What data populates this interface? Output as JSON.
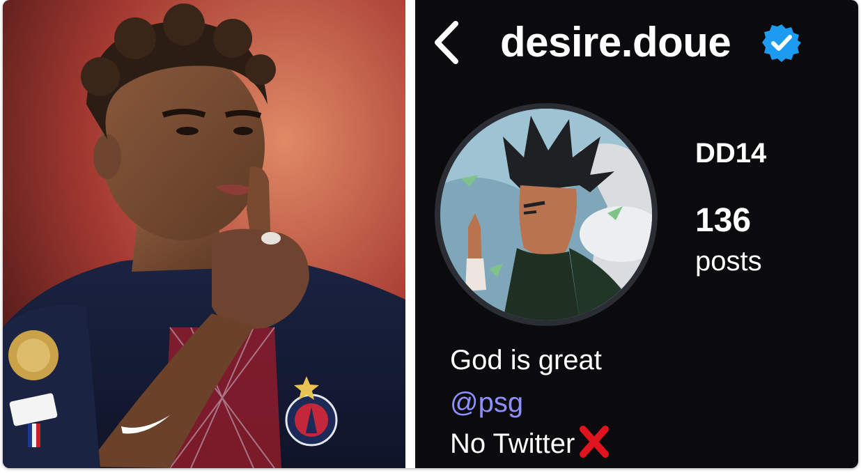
{
  "profile": {
    "username": "desire.doue",
    "display_name": "DD14",
    "post_count": "136",
    "post_label": "posts",
    "bio": {
      "line1": "God is great",
      "mention": "@psg",
      "line3": "No Twitter"
    }
  },
  "icons": {
    "back": "chevron-left-icon",
    "verified": "verified-badge-icon",
    "cross": "red-cross-icon"
  },
  "colors": {
    "background": "#0b0b0d",
    "text": "#ffffff",
    "mention": "#8f8fff",
    "verified": "#1d9bf0",
    "cross": "#e0141e"
  }
}
